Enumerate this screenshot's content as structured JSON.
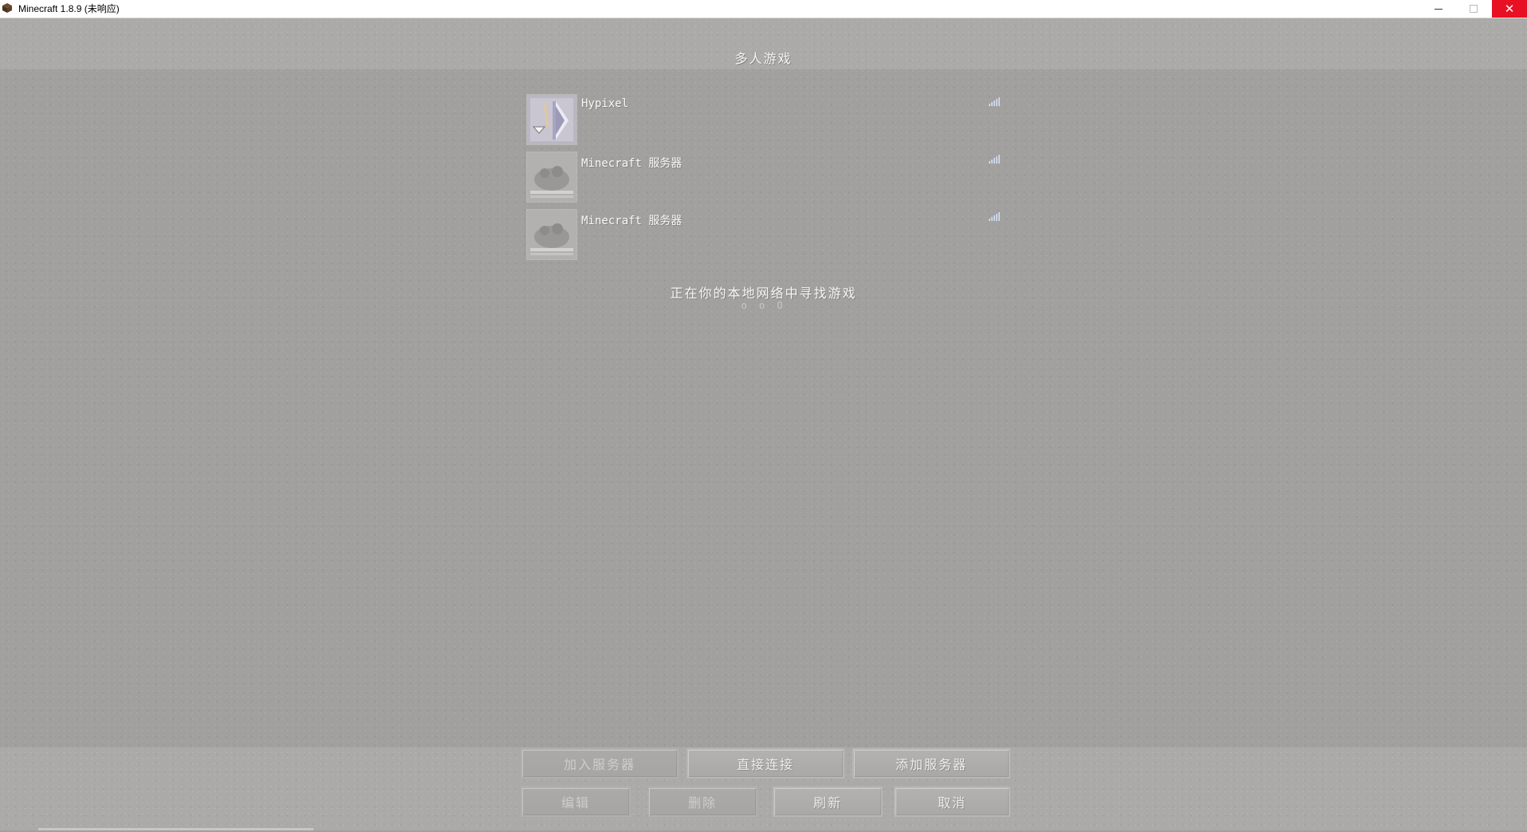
{
  "window": {
    "title": "Minecraft 1.8.9 (未响应)",
    "close_color": "#e81123"
  },
  "screen": {
    "title": "多人游戏"
  },
  "servers": [
    {
      "name": "Hypixel",
      "icon": "hypixel-logo-icon",
      "signal": "signal-bars-icon"
    },
    {
      "name": "Minecraft 服务器",
      "icon": "default-server-icon",
      "signal": "signal-bars-icon"
    },
    {
      "name": "Minecraft 服务器",
      "icon": "default-server-icon",
      "signal": "signal-bars-icon"
    }
  ],
  "lan": {
    "status": "正在你的本地网络中寻找游戏",
    "dots": "o o O"
  },
  "buttons": {
    "join": "加入服务器",
    "direct": "直接连接",
    "add": "添加服务器",
    "edit": "编辑",
    "delete": "删除",
    "refresh": "刷新",
    "cancel": "取消"
  }
}
